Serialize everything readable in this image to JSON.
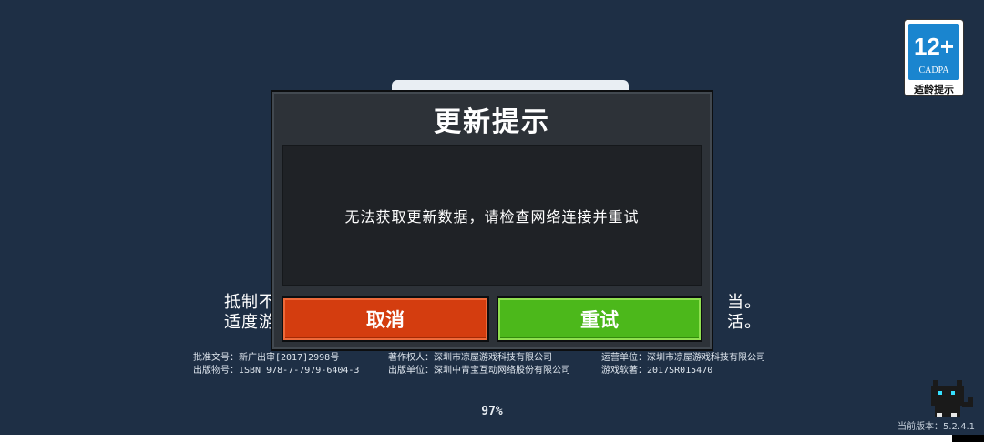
{
  "background": {
    "warning_line1_left": "抵制不",
    "warning_line1_right": "当。",
    "warning_line2_left": "适度游",
    "warning_line2_right": "活。",
    "legal": {
      "row1": [
        "批准文号：新广出审[2017]2998号",
        "著作权人：深圳市凉屋游戏科技有限公司",
        "运营单位：深圳市凉屋游戏科技有限公司"
      ],
      "row2": [
        "出版物号：ISBN 978-7-7979-6404-3",
        "出版单位：深圳中青宝互动网络股份有限公司",
        "游戏软著：2017SR015470"
      ]
    },
    "progress_text": "97%",
    "version_text": "当前版本：5.2.4.1"
  },
  "age_badge": {
    "rating": "12+",
    "org": "CADPA",
    "tip": "适龄提示"
  },
  "dialog": {
    "title": "更新提示",
    "message": "无法获取更新数据，请检查网络连接并重试",
    "cancel_label": "取消",
    "retry_label": "重试"
  },
  "colors": {
    "background": "#1e2f45",
    "cancel_button": "#d43d0f",
    "retry_button": "#4cb81b",
    "dialog_bg": "#2d3238"
  }
}
